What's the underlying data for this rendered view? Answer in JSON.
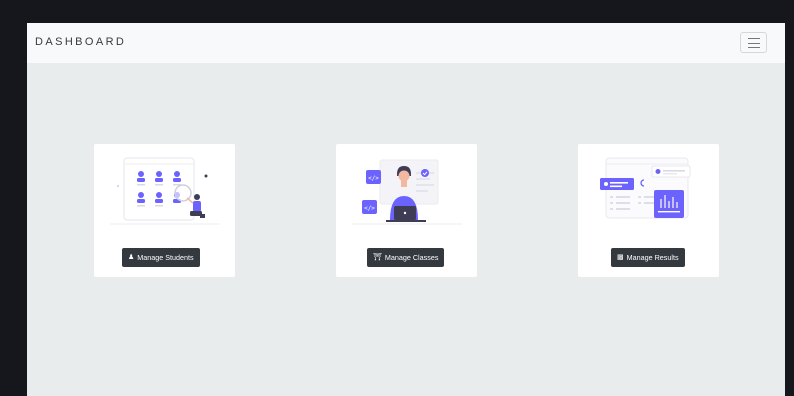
{
  "navbar": {
    "brand": "DASHBOARD",
    "menu_icon": "hamburger-menu-icon"
  },
  "cards": [
    {
      "label": "Manage Students",
      "icon": "users-icon",
      "illustration": "students-grid-illustration"
    },
    {
      "label": "Manage Classes",
      "icon": "institution-icon",
      "illustration": "developer-laptop-illustration"
    },
    {
      "label": "Manage Results",
      "icon": "square-poll-icon",
      "illustration": "analytics-dashboard-illustration"
    }
  ],
  "colors": {
    "accent": "#6c63ff",
    "button_bg": "#33393f",
    "page_bg": "#e8ecec",
    "navbar_bg": "#f8f9fa",
    "outer_bg": "#15171c"
  }
}
